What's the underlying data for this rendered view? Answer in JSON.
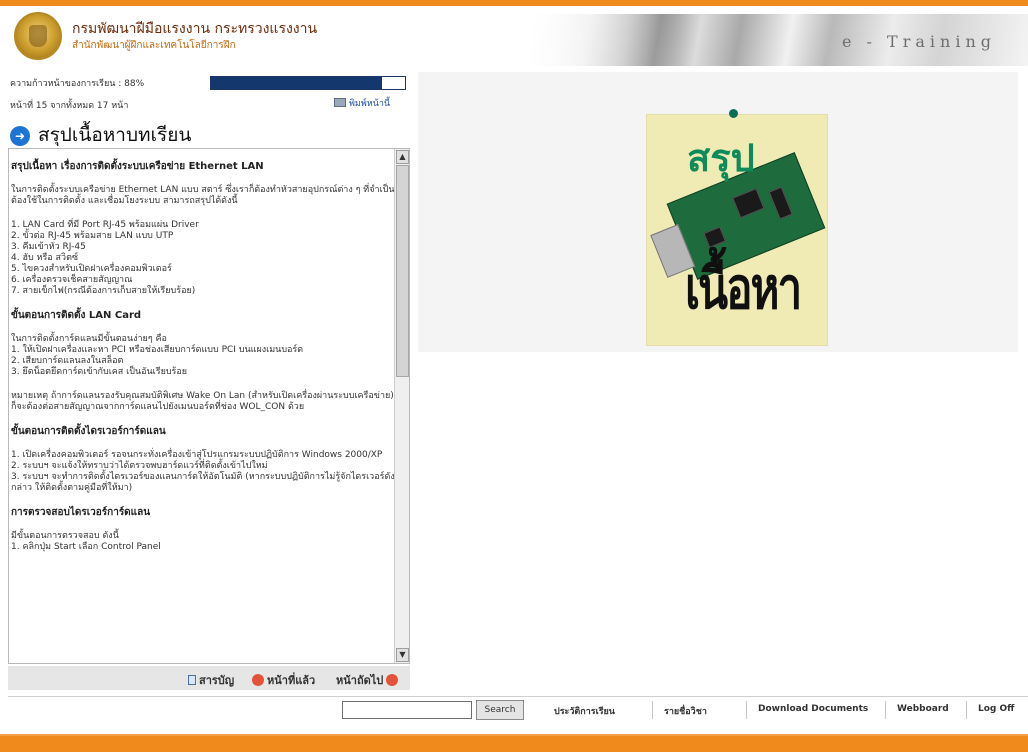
{
  "header": {
    "org_name": "กรมพัฒนาฝีมือแรงงาน กระทรวงแรงงาน",
    "org_sub": "สำนักพัฒนาผู้ฝึกและเทคโนโลยีการฝึก",
    "banner_text": "e - Training"
  },
  "lesson": {
    "progress_label": "ความก้าวหน้าของการเรียน : 88%",
    "progress_value": 88,
    "page_count": "หน้าที่ 15 จากทั้งหมด 17 หน้า",
    "print_label": "พิมพ์หน้านี้",
    "section_title": "สรุปเนื้อหาบทเรียน"
  },
  "content": {
    "heading1": "สรุปเนื้อหา เรื่องการติดตั้งระบบเครือข่าย Ethernet LAN",
    "intro": "ในการติดตั้งระบบเครือข่าย Ethernet LAN แบบ สตาร์ ซึ่งเราก็ต้องทำหัวสายอุปกรณ์ต่าง ๆ ที่จำเป็นต้องใช้ในการติดตั้ง และเชื่อมโยงระบบ สามารถสรุปได้ดังนี้",
    "list1": [
      "1. LAN Card ที่มี Port RJ-45 พร้อมแผ่น Driver",
      "2. ขั้วต่อ RJ-45 พร้อมสาย LAN แบบ UTP",
      "3. คีมเข้าหัว RJ-45",
      "4. ฮับ หรือ สวิตซ์",
      "5. ไขควงสำหรับเปิดฝาเครื่องคอมพิวเตอร์",
      "6. เครื่องตรวจเช็คสายสัญญาณ",
      "7. สายเข็กไฟ(กรณีต้องการเก็บสายให้เรียบร้อย)"
    ],
    "heading2": "ขั้นตอนการติดตั้ง LAN Card",
    "steps_intro": "ในการติดตั้งการ์ดแลนมีขั้นตอนง่ายๆ คือ",
    "list2": [
      "1. ให้เปิดฝาเครื่องและหา PCI หรือช่องเสียบการ์ดแบบ PCI บนแผงเมนบอร์ด",
      "2. เสียบการ์ดแลนลงในสล็อต",
      "3. ยึดน็อตยึดการ์ดเข้ากับเคส เป็นอันเรียบร้อย"
    ],
    "note": "หมายเหตุ ถ้าการ์ดแลนรองรับคุณสมบัติพิเศษ Wake On Lan (สำหรับเปิดเครื่องผ่านระบบเครือข่าย) ก็จะต้องต่อสายสัญญาณจากการ์ดแลนไปยังเมนบอร์ดที่ช่อง WOL_CON ด้วย",
    "heading3": "ขั้นตอนการติดตั้งไดรเวอร์การ์ดแลน",
    "list3": [
      "1. เปิดเครื่องคอมพิวเตอร์ รอจนกระทั่งเครื่องเข้าสู่โปรแกรมระบบปฏิบัติการ Windows 2000/XP",
      "2. ระบบฯ จะแจ้งให้ทราบว่าได้ตรวจพบฮาร์ดแวร์ที่ติดตั้งเข้าไปใหม่",
      "3. ระบบฯ จะทำการติดตั้งไดรเวอร์ของแลนการ์ดให้อัตโนมัติ (หากระบบปฏิบัติการไม่รู้จักไดรเวอร์ดังกล่าว ให้ติดตั้งตามคู่มือที่ให้มา)"
    ],
    "heading4": "การตรวจสอบไดรเวอร์การ์ดแลน",
    "check_intro": "มีขั้นตอนการตรวจสอบ ดังนี้",
    "check_step1": "1. คลิกปุ่ม Start เลือก Control Panel"
  },
  "nav": {
    "contents": "สารบัญ",
    "previous": "หน้าที่แล้ว",
    "next": "หน้าถัดไป"
  },
  "illustration": {
    "title": "สรุป",
    "subtitle": "เนื้อหา"
  },
  "footer": {
    "search_value": "",
    "search_button": "Search",
    "history": "ประวัติการเรียน",
    "courses": "รายชื่อวิชา",
    "download": "Download Documents",
    "webboard": "Webboard",
    "logoff": "Log Off"
  },
  "colors": {
    "accent_orange": "#f08a1c",
    "progress_navy": "#14386e",
    "title_green": "#0e8a5b"
  },
  "icons": [
    "logo-seal",
    "arrow-right-icon",
    "printer-icon",
    "document-icon",
    "back-icon",
    "next-icon"
  ]
}
